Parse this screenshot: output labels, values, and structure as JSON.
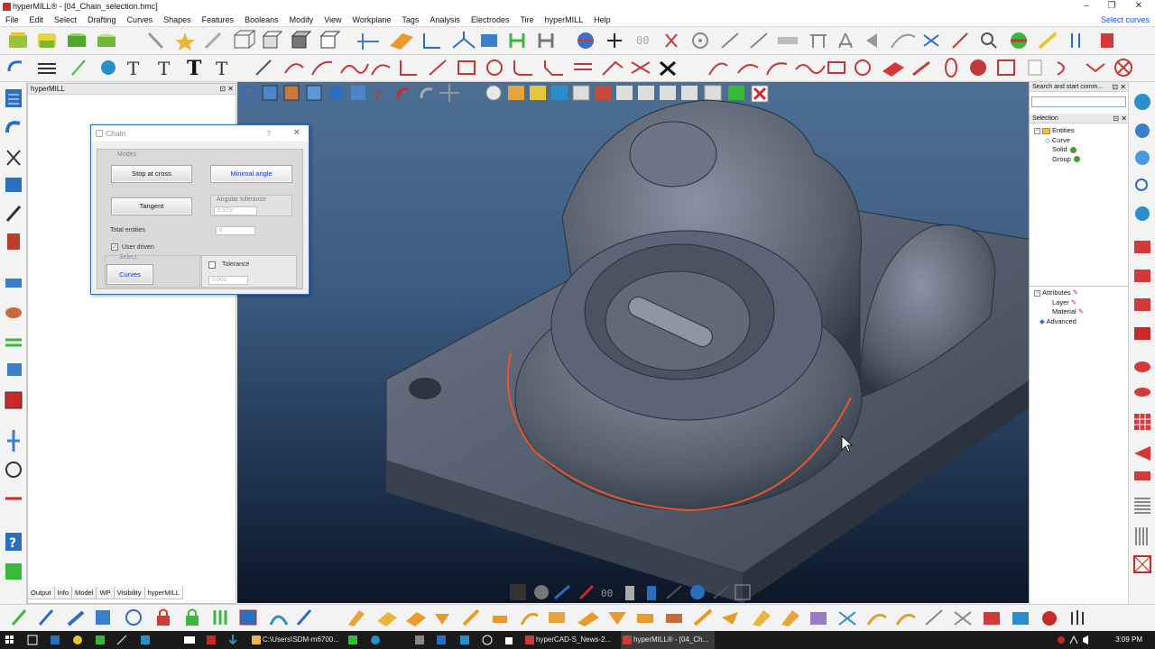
{
  "window": {
    "title": "hyperMILL® - [04_Chain_selection.hmc]",
    "controls": {
      "minimize": "–",
      "restore": "❐",
      "close": "✕"
    },
    "app_icon": "hypermill-app-icon"
  },
  "menu": {
    "items": [
      "File",
      "Edit",
      "Select",
      "Drafting",
      "Curves",
      "Shapes",
      "Features",
      "Booleans",
      "Modify",
      "View",
      "Workplane",
      "Tags",
      "Analysis",
      "Electrodes",
      "Tire",
      "hyperMILL",
      "Help"
    ],
    "right_label": "Select curves"
  },
  "hypermill_panel": {
    "title": "hyperMILL",
    "pin": "⊡",
    "close": "✕",
    "tabs": [
      "Output",
      "Info",
      "Model",
      "WP",
      "Visibility",
      "hyperMILL"
    ],
    "active_tab": "hyperMILL"
  },
  "chain_dialog": {
    "title": "Chain",
    "help": "?",
    "close": "✕",
    "modes_label": "Modes",
    "stop_at_cross": "Stop at cross",
    "minimal_angle": "Minimal angle",
    "tangent": "Tangent",
    "angular_tolerance_label": "Angular tolerance",
    "angular_tolerance_value": "0.573°",
    "total_entities_label": "Total entities",
    "total_entities_value": "0",
    "user_driven_label": "User driven",
    "user_driven_checked": "✓",
    "select_label": "Select",
    "curves_button": "Curves",
    "tolerance_label": "Tolerance",
    "tolerance_value": "0.001"
  },
  "search_panel": {
    "title": "Search and start comm...",
    "pin": "⊡",
    "close": "✕",
    "placeholder": ""
  },
  "selection_panel": {
    "title": "Selection",
    "pin": "⊡",
    "close": "✕",
    "tree": {
      "root": "Entities",
      "children": [
        "Curve",
        "Solid",
        "Group"
      ]
    },
    "attributes": {
      "root": "Attributes",
      "children": [
        "Layer",
        "Material"
      ],
      "advanced": "Advanced"
    }
  },
  "taskbar": {
    "items": [
      {
        "label": "C:\\Users\\SDM-m6700...",
        "color": "#e8b64a"
      },
      {
        "label": "hyperCAD-S_News-2...",
        "color": "#c43e3e"
      },
      {
        "label": "hyperMILL® - [04_Ch...",
        "color": "#c43e3e"
      }
    ],
    "clock": "3:09 PM"
  },
  "colors": {
    "accent_blue": "#1a37c7",
    "selection_red": "#e2582a",
    "viewport_top": "#4e6f94",
    "viewport_bottom": "#0c1626",
    "dialog_border": "#2f6db5"
  }
}
